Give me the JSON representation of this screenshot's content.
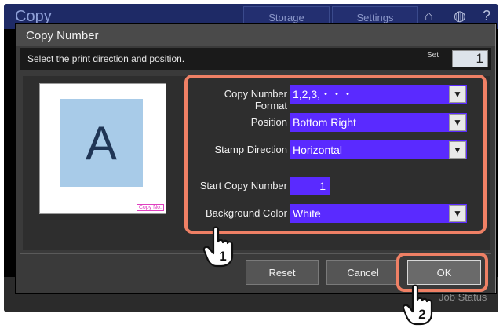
{
  "background": {
    "app_title": "Copy",
    "tabs": [
      "Storage",
      "Settings"
    ],
    "icons": [
      "home-icon",
      "globe-icon",
      "help-icon"
    ],
    "job_status": "Job Status"
  },
  "dialog": {
    "title": "Copy Number",
    "message": "Select the print direction and position.",
    "set_label": "Set",
    "set_value": "1",
    "preview": {
      "letter": "A",
      "copy_no": "Copy No."
    },
    "fields": {
      "format_label": "Copy Number Format",
      "format_value": "1,2,3,・・・",
      "position_label": "Position",
      "position_value": "Bottom Right",
      "direction_label": "Stamp Direction",
      "direction_value": "Horizontal",
      "start_label": "Start Copy Number",
      "start_value": "1",
      "bgcolor_label": "Background Color",
      "bgcolor_value": "White"
    },
    "buttons": {
      "reset": "Reset",
      "cancel": "Cancel",
      "ok": "OK"
    }
  },
  "annotations": {
    "step1": "1",
    "step2": "2",
    "highlight_color": "#ef8065"
  }
}
